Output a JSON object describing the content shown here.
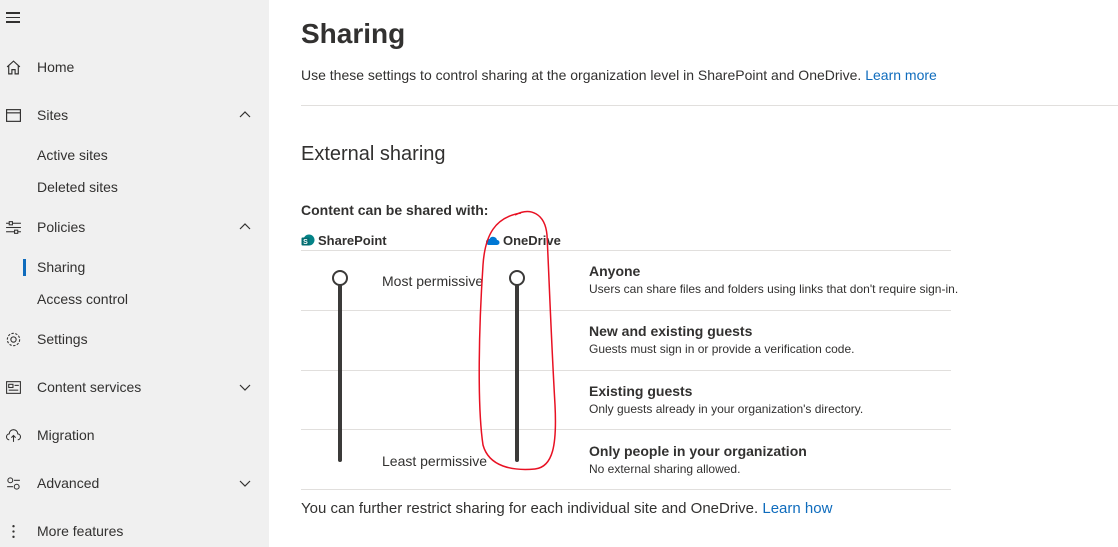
{
  "sidebar": {
    "items": [
      {
        "label": "Home",
        "icon": "home-icon"
      },
      {
        "label": "Sites",
        "icon": "sites-icon"
      },
      {
        "label": "Active sites"
      },
      {
        "label": "Deleted sites"
      },
      {
        "label": "Policies",
        "icon": "policies-icon"
      },
      {
        "label": "Sharing"
      },
      {
        "label": "Access control"
      },
      {
        "label": "Settings",
        "icon": "gear-icon"
      },
      {
        "label": "Content services",
        "icon": "content-services-icon"
      },
      {
        "label": "Migration",
        "icon": "cloud-upload-icon"
      },
      {
        "label": "Advanced",
        "icon": "advanced-icon"
      },
      {
        "label": "More features",
        "icon": "more-icon"
      }
    ],
    "selected": "Sharing"
  },
  "main": {
    "title": "Sharing",
    "description": "Use these settings to control sharing at the organization level in SharePoint and OneDrive.",
    "learn_more": "Learn more",
    "section_title": "External sharing",
    "shared_with_label": "Content can be shared with:",
    "columns": {
      "sharepoint": "SharePoint",
      "onedrive": "OneDrive"
    },
    "most_permissive": "Most permissive",
    "least_permissive": "Least permissive",
    "options": [
      {
        "title": "Anyone",
        "desc": "Users can share files and folders using links that don't require sign-in."
      },
      {
        "title": "New and existing guests",
        "desc": "Guests must sign in or provide a verification code."
      },
      {
        "title": "Existing guests",
        "desc": "Only guests already in your organization's directory."
      },
      {
        "title": "Only people in your organization",
        "desc": "No external sharing allowed."
      }
    ],
    "footer_text": "You can further restrict sharing for each individual site and OneDrive.",
    "learn_how": "Learn how"
  },
  "colors": {
    "sidebar_bg": "#f0f0f0",
    "accent": "#0f6cbd",
    "annotation": "#e81123",
    "sharepoint": "#038387",
    "onedrive": "#0078d4"
  }
}
